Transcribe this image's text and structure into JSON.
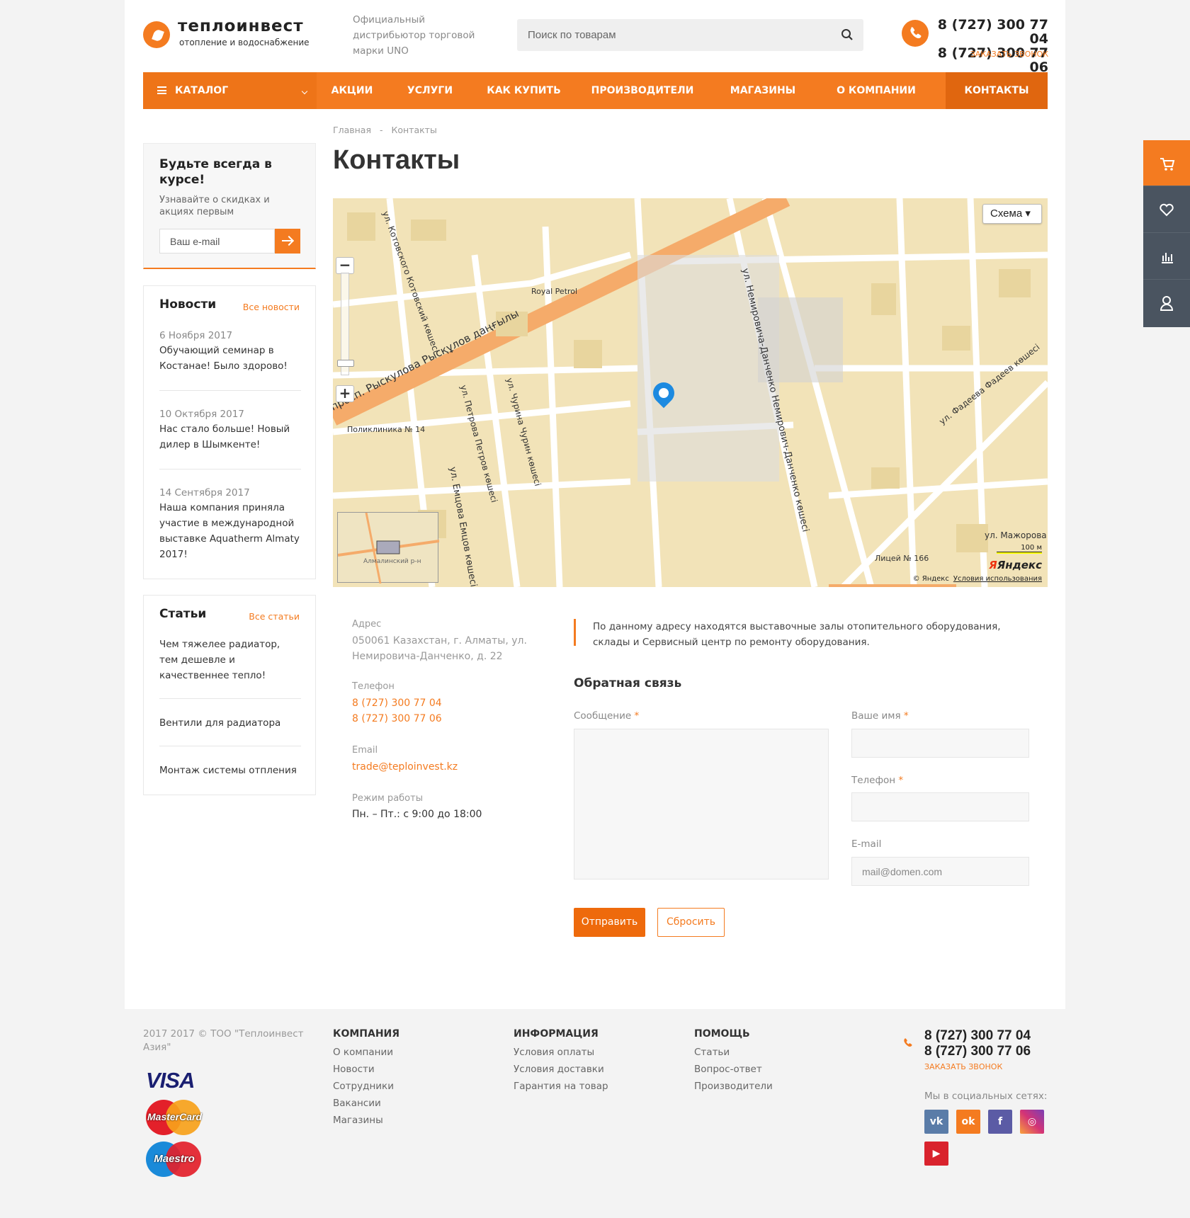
{
  "header": {
    "logo_name": "теплоинвест",
    "logo_sub": "отопление и водоснабжение",
    "tagline": "Официальный дистрибьютор торговой марки UNO",
    "search_placeholder": "Поиск по товарам",
    "phone1": "8 (727) 300 77 04",
    "phone2": "8 (727) 300 77 06",
    "callback": "ЗАКАЗАТЬ ЗВОНОК"
  },
  "nav": {
    "catalog": "КАТАЛОГ",
    "items": [
      "АКЦИИ",
      "УСЛУГИ",
      "КАК КУПИТЬ",
      "ПРОИЗВОДИТЕЛИ",
      "МАГАЗИНЫ",
      "О КОМПАНИИ",
      "КОНТАКТЫ"
    ],
    "active": "КОНТАКТЫ"
  },
  "breadcrumbs": [
    "Главная",
    "-",
    "Контакты"
  ],
  "page_title": "Контакты",
  "subscribe": {
    "title": "Будьте всегда в курсе!",
    "text": "Узнавайте о скидках и акциях первым",
    "placeholder": "Ваш e-mail"
  },
  "news": {
    "title": "Новости",
    "all_link": "Все новости",
    "items": [
      {
        "date": "6 Ноября 2017",
        "text": "Обучающий семинар в Костанае! Было здорово!"
      },
      {
        "date": "10 Октября 2017",
        "text": "Нас стало больше! Новый дилер в Шымкенте!"
      },
      {
        "date": "14 Сентября 2017",
        "text": "Наша компания приняла участие в международной выставке Aquatherm Almaty 2017!"
      }
    ]
  },
  "articles": {
    "title": "Статьи",
    "all_link": "Все статьи",
    "items": [
      "Чем тяжелее радиатор, тем дешевле и качественнее тепло!",
      "Вентили для радиатора",
      "Монтаж системы отпления"
    ]
  },
  "map": {
    "type_button": "Схема",
    "street_main": "просп. Рыскулова  Рысқұлов даңғылы",
    "street_nem": "ул. Немировича-Данченко  Немирович-Данченко көшесі",
    "street_emtsova": "ул. Емцова  Емцов көшесі",
    "street_petrova": "ул. Петрова  Петров көшесі",
    "street_churina": "ул. Чурина  Чурин көшесі",
    "street_fadeeva": "ул. Фадеева  Фадеев көшесі",
    "street_kotovskogo": "ул. Котовского  Котовский көшесі",
    "street_mazhorova": "ул. Мажорова",
    "poi_royal": "Royal Petrol",
    "poi_clinic": "Поликлиника № 14",
    "poi_lyceum": "Лицей № 166",
    "mini_label": "Алмалинский р-н",
    "scale": "100 м",
    "logo": "Яндекс",
    "copyright": "© Яндекс",
    "terms": "Условия использования"
  },
  "contacts": {
    "address_label": "Адрес",
    "address": "050061 Казахстан, г. Алматы, ул. Немировича-Данченко, д. 22",
    "phone_label": "Телефон",
    "phone1": "8 (727) 300 77 04",
    "phone2": "8 (727) 300 77 06",
    "email_label": "Email",
    "email": "trade@teploinvest.kz",
    "hours_label": "Режим работы",
    "hours": "Пн. – Пт.: с 9:00 до 18:00"
  },
  "note": "По данному адресу находятся выставочные залы отопительного оборудования, склады и Сервисный центр по ремонту оборудования.",
  "feedback": {
    "title": "Обратная связь",
    "message_label": "Сообщение",
    "name_label": "Ваше имя",
    "phone_label": "Телефон",
    "email_label": "E-mail",
    "email_placeholder": "mail@domen.com",
    "required_mark": "*",
    "send": "Отправить",
    "reset": "Сбросить"
  },
  "footer": {
    "copyright": "2017 2017 © ТОО \"Теплоинвест Азия\"",
    "cards": [
      "VISA",
      "MasterCard",
      "Maestro"
    ],
    "columns": [
      {
        "title": "КОМПАНИЯ",
        "links": [
          "О компании",
          "Новости",
          "Сотрудники",
          "Вакансии",
          "Магазины"
        ]
      },
      {
        "title": "ИНФОРМАЦИЯ",
        "links": [
          "Условия оплаты",
          "Условия доставки",
          "Гарантия на товар"
        ]
      },
      {
        "title": "ПОМОЩЬ",
        "links": [
          "Статьи",
          "Вопрос-ответ",
          "Производители"
        ]
      }
    ],
    "phone1": "8 (727) 300 77 04",
    "phone2": "8 (727) 300 77 06",
    "callback": "ЗАКАЗАТЬ ЗВОНОК",
    "social_label": "Мы в социальных сетях:",
    "social": [
      "vk-icon",
      "odnoklassniki-icon",
      "facebook-icon",
      "instagram-icon",
      "youtube-icon"
    ]
  },
  "colors": {
    "accent": "#f47b20",
    "nav_active": "#e0660f",
    "side_panel": "#4a5460"
  }
}
